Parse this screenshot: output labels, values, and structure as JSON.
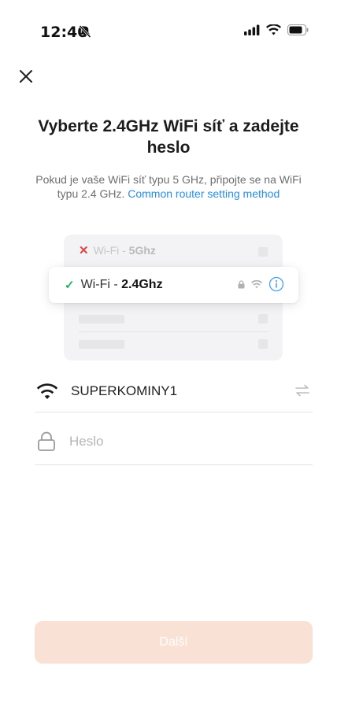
{
  "status_bar": {
    "time": "12:40",
    "icons": [
      "bell-muted-icon",
      "signal-icon",
      "wifi-icon",
      "battery-icon"
    ]
  },
  "header": {
    "close_icon": "close-icon"
  },
  "title": "Vyberte 2.4GHz WiFi síť a zadejte heslo",
  "subtitle": {
    "text": "Pokud je vaše WiFi síť typu 5 GHz, připojte se na WiFi typu 2.4 GHz. ",
    "link": "Common router setting method"
  },
  "illustration": {
    "bad": {
      "prefix": "Wi-Fi - ",
      "band": "5Ghz",
      "icon": "x-icon"
    },
    "good": {
      "prefix": "Wi-Fi - ",
      "band": "2.4Ghz",
      "icon": "check-icon",
      "extra_icons": [
        "lock-icon",
        "wifi-icon",
        "info-icon"
      ]
    }
  },
  "form": {
    "ssid": {
      "value": "SUPERKOMINY1",
      "icon": "wifi-icon",
      "action_icon": "switch-arrows-icon"
    },
    "password": {
      "placeholder": "Heslo",
      "value": "",
      "icon": "lock-icon"
    }
  },
  "next_button": {
    "label": "Další",
    "color": "#fae1d5"
  },
  "colors": {
    "link": "#2a8ee6",
    "check": "#21b36b",
    "error": "#e04444"
  }
}
